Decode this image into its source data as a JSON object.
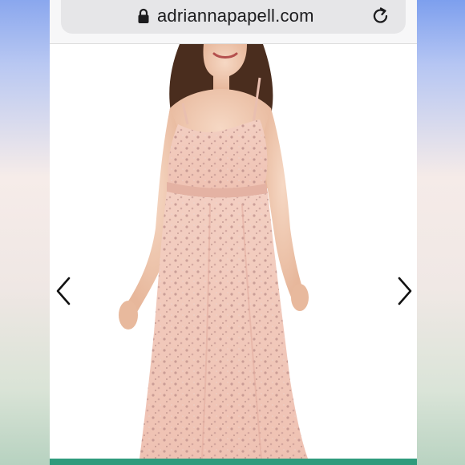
{
  "browser": {
    "url": "adriannapapell.com"
  },
  "icons": {
    "lock": "lock-icon",
    "reload": "reload-icon",
    "prev": "chevron-left-icon",
    "next": "chevron-right-icon"
  },
  "colors": {
    "dress": "#f0c6b8",
    "accent_strip": "#2f9b7c"
  }
}
